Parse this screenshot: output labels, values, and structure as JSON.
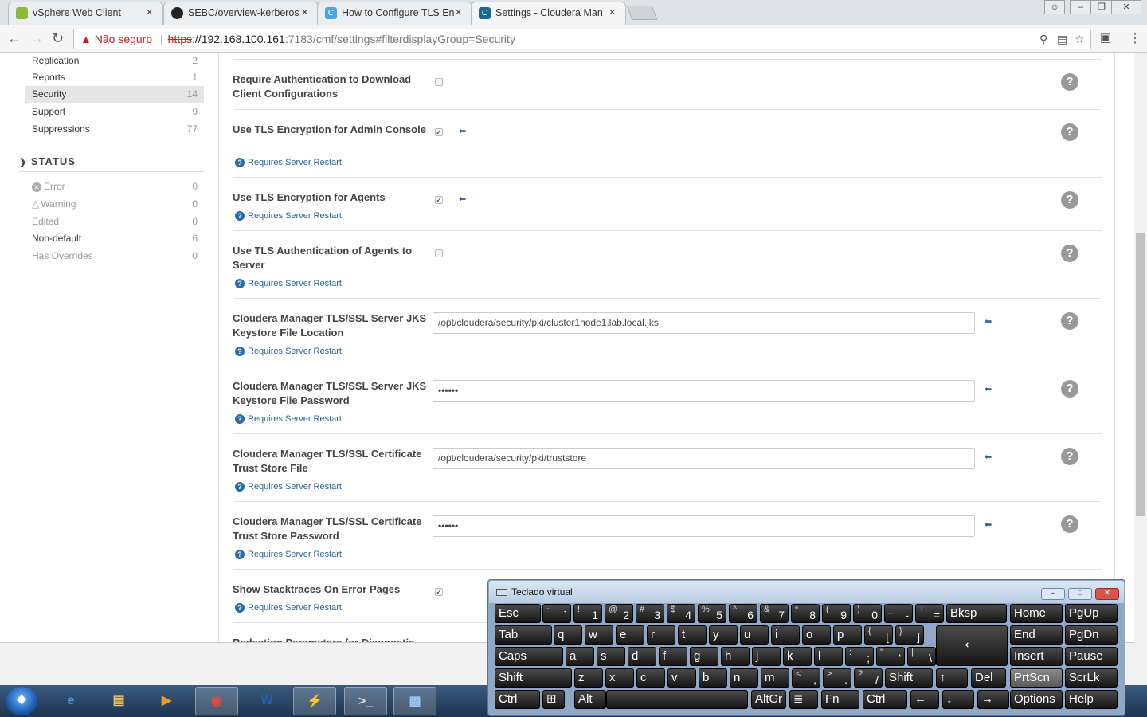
{
  "browser": {
    "tabs": [
      {
        "title": "vSphere Web Client",
        "icon": "vsphere-icon",
        "color": "#8cb93d"
      },
      {
        "title": "SEBC/overview-kerberos",
        "icon": "github-icon",
        "color": "#222222"
      },
      {
        "title": "How to Configure TLS En",
        "icon": "cloudera-icon",
        "color": "#4aa3df"
      },
      {
        "title": "Settings - Cloudera Man",
        "icon": "cloudera-icon",
        "color": "#1b6a8c"
      }
    ],
    "address": {
      "security_label": "Não seguro",
      "scheme": "https",
      "host": "://192.168.100.161",
      "path": ":7183/cmf/settings#filterdisplayGroup=Security"
    }
  },
  "sidebar": {
    "categories": [
      {
        "label": "Replication",
        "count": "2"
      },
      {
        "label": "Reports",
        "count": "1"
      },
      {
        "label": "Security",
        "count": "14",
        "selected": true
      },
      {
        "label": "Support",
        "count": "9"
      },
      {
        "label": "Suppressions",
        "count": "77"
      }
    ],
    "status_header": "STATUS",
    "status": [
      {
        "label": "Error",
        "count": "0",
        "icon": "error-icon"
      },
      {
        "label": "Warning",
        "count": "0",
        "icon": "warning-icon"
      },
      {
        "label": "Edited",
        "count": "0"
      },
      {
        "label": "Non-default",
        "count": "6"
      },
      {
        "label": "Has Overrides",
        "count": "0"
      }
    ]
  },
  "settings": {
    "restart_note": "Requires Server Restart",
    "rows": [
      {
        "label": "Require Authentication to Download Client Configurations",
        "type": "checkbox",
        "checked": false,
        "restart": false
      },
      {
        "label": "Use TLS Encryption for Admin Console",
        "type": "checkbox",
        "checked": true,
        "restart": true
      },
      {
        "label": "Use TLS Encryption for Agents",
        "type": "checkbox",
        "checked": true,
        "restart": true
      },
      {
        "label": "Use TLS Authentication of Agents to Server",
        "type": "checkbox",
        "checked": false,
        "restart": true
      },
      {
        "label": "Cloudera Manager TLS/SSL Server JKS Keystore File Location",
        "type": "text",
        "value": "/opt/cloudera/security/pki/cluster1node1.lab.local.jks",
        "restart": true
      },
      {
        "label": "Cloudera Manager TLS/SSL Server JKS Keystore File Password",
        "type": "password",
        "value": "••••••",
        "restart": true
      },
      {
        "label": "Cloudera Manager TLS/SSL Certificate Trust Store File",
        "type": "text",
        "value": "/opt/cloudera/security/pki/truststore",
        "restart": true
      },
      {
        "label": "Cloudera Manager TLS/SSL Certificate Trust Store Password",
        "type": "password",
        "value": "••••••",
        "restart": true
      },
      {
        "label": "Show Stacktraces On Error Pages",
        "type": "checkbox",
        "checked": true,
        "restart": true
      },
      {
        "label": "Redaction Parameters for Diagnostic",
        "type": "partial"
      }
    ]
  },
  "keyboard": {
    "title": "Teclado virtual",
    "rows": [
      [
        "Esc",
        "~ `",
        "! 1",
        "@ 2",
        "# 3",
        "$ 4",
        "% 5",
        "^ 6",
        "& 7",
        "* 8",
        "( 9",
        ") 0",
        "_ -",
        "+ =",
        "Bksp",
        "Home",
        "PgUp"
      ],
      [
        "Tab",
        "q",
        "w",
        "e",
        "r",
        "t",
        "y",
        "u",
        "i",
        "o",
        "p",
        "{ [",
        "} ]",
        "Enter",
        "End",
        "PgDn"
      ],
      [
        "Caps",
        "a",
        "s",
        "d",
        "f",
        "g",
        "h",
        "j",
        "k",
        "l",
        ": ;",
        "\" '",
        "| \\",
        "Insert",
        "Pause"
      ],
      [
        "Shift",
        "z",
        "x",
        "c",
        "v",
        "b",
        "n",
        "m",
        "< ,",
        "> .",
        "? /",
        "Shift",
        "↑",
        "Del",
        "PrtScn",
        "ScrLk"
      ],
      [
        "Ctrl",
        "Win",
        "Alt",
        "Space",
        "AltGr",
        "Menu",
        "Fn",
        "Ctrl",
        "←",
        "↓",
        "→",
        "Options",
        "Help"
      ]
    ]
  },
  "taskbar": {
    "apps": [
      "start-button",
      "ie-icon",
      "explorer-icon",
      "media-icon",
      "chrome-icon",
      "word-icon",
      "putty-icon",
      "cmd-icon",
      "network-icon"
    ]
  }
}
